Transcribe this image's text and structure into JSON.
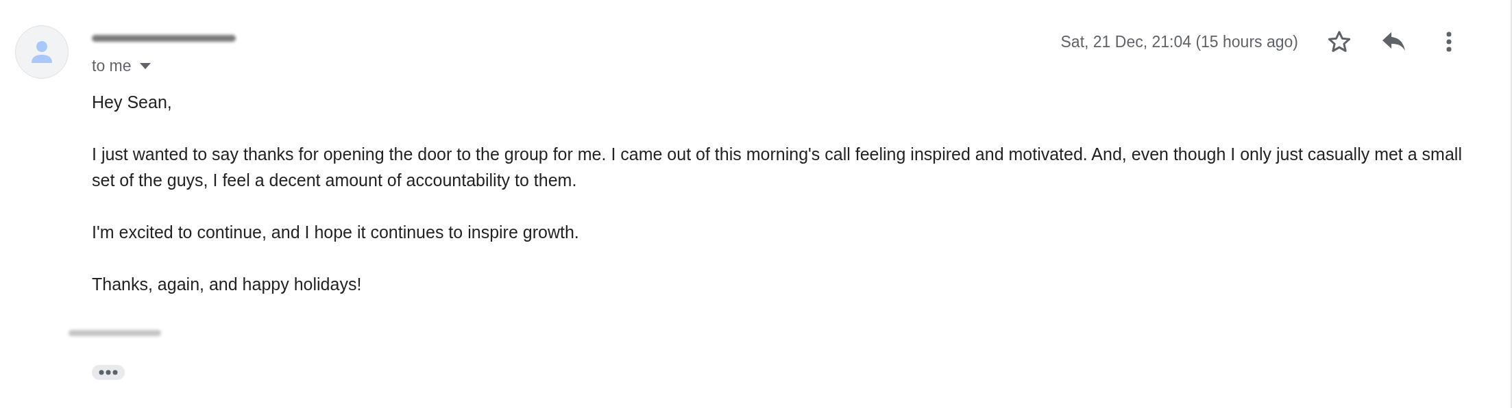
{
  "message": {
    "sender": {
      "redacted": true
    },
    "recipient": "to me",
    "date": "Sat, 21 Dec, 21:04 (15 hours ago)",
    "starred": false,
    "paragraphs": [
      "Hey Sean,",
      "I just wanted to say thanks for opening the door to the group for me. I came out of this morning's call feeling inspired and motivated. And, even though I only just casually met a small set of the guys, I feel a decent amount of accountability to them.",
      "I'm excited to continue, and I hope it continues to inspire growth.",
      "Thanks, again, and happy holidays!"
    ],
    "signature": {
      "redacted": true
    }
  }
}
